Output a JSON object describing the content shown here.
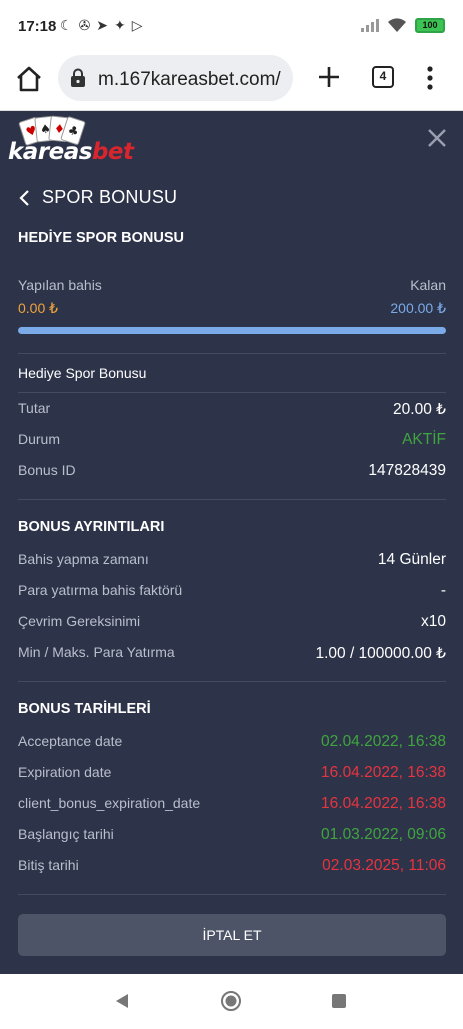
{
  "status_bar": {
    "time": "17:18",
    "battery": "100"
  },
  "browser": {
    "url": "m.167kareasbet.com/",
    "tab_count": "4"
  },
  "header": {
    "logo_text_part1": "kareas",
    "logo_text_part2": "bet",
    "back_icon": "chevron-left-icon",
    "title": "SPOR BONUSU",
    "close_icon": "close-icon"
  },
  "bonus": {
    "heading": "HEDİYE SPOR BONUSU",
    "progress": {
      "made_label": "Yapılan bahis",
      "made_value": "0.00 ₺",
      "remaining_label": "Kalan",
      "remaining_value": "200.00 ₺",
      "fraction_done": 0
    },
    "name": "Hediye Spor Bonusu",
    "rows": [
      {
        "label": "Tutar",
        "value": "20.00 ₺"
      },
      {
        "label": "Durum",
        "value": "AKTİF"
      },
      {
        "label": "Bonus ID",
        "value": "147828439"
      }
    ]
  },
  "details": {
    "heading": "BONUS AYRINTILARI",
    "rows": [
      {
        "label": "Bahis yapma zamanı",
        "value": "14 Günler"
      },
      {
        "label": "Para yatırma bahis faktörü",
        "value": "-"
      },
      {
        "label": "Çevrim Gereksinimi",
        "value": "x10"
      },
      {
        "label": "Min / Maks. Para Yatırma",
        "value": "1.00 / 100000.00 ₺"
      }
    ]
  },
  "dates": {
    "heading": "BONUS TARİHLERİ",
    "rows": [
      {
        "label": "Acceptance date",
        "value": "02.04.2022, 16:38"
      },
      {
        "label": "Expiration date",
        "value": "16.04.2022, 16:38"
      },
      {
        "label": "client_bonus_expiration_date",
        "value": "16.04.2022, 16:38"
      },
      {
        "label": "Başlangıç tarihi",
        "value": "01.03.2022, 09:06"
      },
      {
        "label": "Bitiş tarihi",
        "value": "02.03.2025, 11:06"
      }
    ]
  },
  "actions": {
    "cancel_label": "İPTAL ET"
  },
  "colors": {
    "page_bg": "#2d3349",
    "orange": "#f0a33a",
    "blue": "#7aaae8",
    "green": "#3fa63f",
    "red": "#e8343f"
  }
}
